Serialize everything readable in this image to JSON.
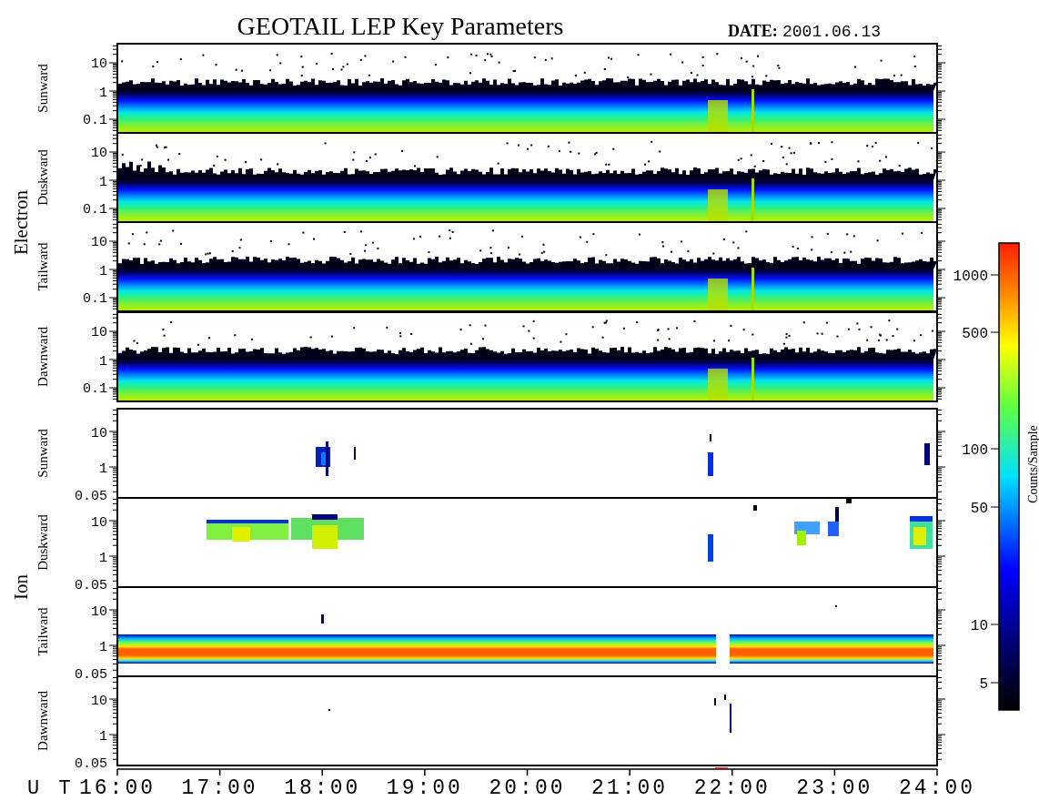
{
  "title": "GEOTAIL LEP Key Parameters",
  "date": {
    "label": "DATE:",
    "value": "2001.06.13"
  },
  "groups": [
    {
      "label": "Electron",
      "kind": "electron",
      "panels": [
        {
          "label": "Sunward",
          "yticks": [
            "10",
            "1",
            "0.1"
          ]
        },
        {
          "label": "Duskward",
          "yticks": [
            "10",
            "1",
            "0.1"
          ]
        },
        {
          "label": "Tailward",
          "yticks": [
            "10",
            "1",
            "0.1"
          ]
        },
        {
          "label": "Dawnward",
          "yticks": [
            "10",
            "1",
            "0.1"
          ]
        }
      ]
    },
    {
      "label": "Ion",
      "kind": "ion",
      "panels": [
        {
          "label": "Sunward",
          "yticks": [
            "10",
            "1",
            "0.05"
          ]
        },
        {
          "label": "Duskward",
          "yticks": [
            "10",
            "1",
            "0.05"
          ]
        },
        {
          "label": "Tailward",
          "yticks": [
            "10",
            "1",
            "0.05"
          ]
        },
        {
          "label": "Dawnward",
          "yticks": [
            "10",
            "1",
            "0.05"
          ]
        }
      ]
    }
  ],
  "x_axis": {
    "label": "U T",
    "ticks": [
      "16:00",
      "17:00",
      "18:00",
      "19:00",
      "20:00",
      "21:00",
      "22:00",
      "23:00",
      "24:00"
    ]
  },
  "colorbar": {
    "title": "Counts/Sample",
    "ticks": [
      "1000",
      "500",
      "100",
      "50",
      "10",
      "5"
    ]
  }
}
